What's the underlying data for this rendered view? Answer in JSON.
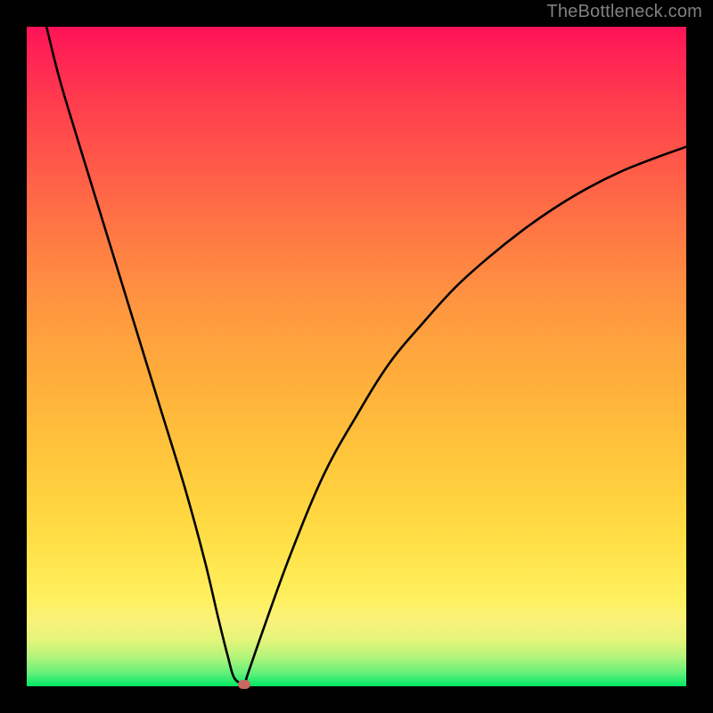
{
  "watermark": "TheBottleneck.com",
  "chart_data": {
    "type": "line",
    "title": "",
    "xlabel": "",
    "ylabel": "",
    "xlim": [
      0,
      100
    ],
    "ylim": [
      0,
      100
    ],
    "background_gradient": {
      "top_color": "#ff1258",
      "bottom_color": "#00e865",
      "meaning": "top=bad/bottleneck, bottom=good/no-bottleneck"
    },
    "series": [
      {
        "name": "bottleneck-curve",
        "x": [
          3,
          5,
          8,
          12,
          16,
          20,
          24,
          27,
          29,
          30.5,
          31.5,
          33,
          33.5,
          36,
          40,
          45,
          50,
          55,
          60,
          65,
          70,
          75,
          80,
          85,
          90,
          95,
          100
        ],
        "values": [
          100,
          92,
          82,
          69,
          56,
          43,
          30,
          19,
          10.5,
          4.5,
          1.2,
          0.5,
          1.8,
          9,
          20,
          32,
          41,
          49,
          55,
          60.5,
          65,
          69,
          72.5,
          75.5,
          78,
          80,
          81.8
        ]
      }
    ],
    "marker": {
      "x": 33,
      "y": 0.3,
      "color": "#c86860"
    }
  }
}
